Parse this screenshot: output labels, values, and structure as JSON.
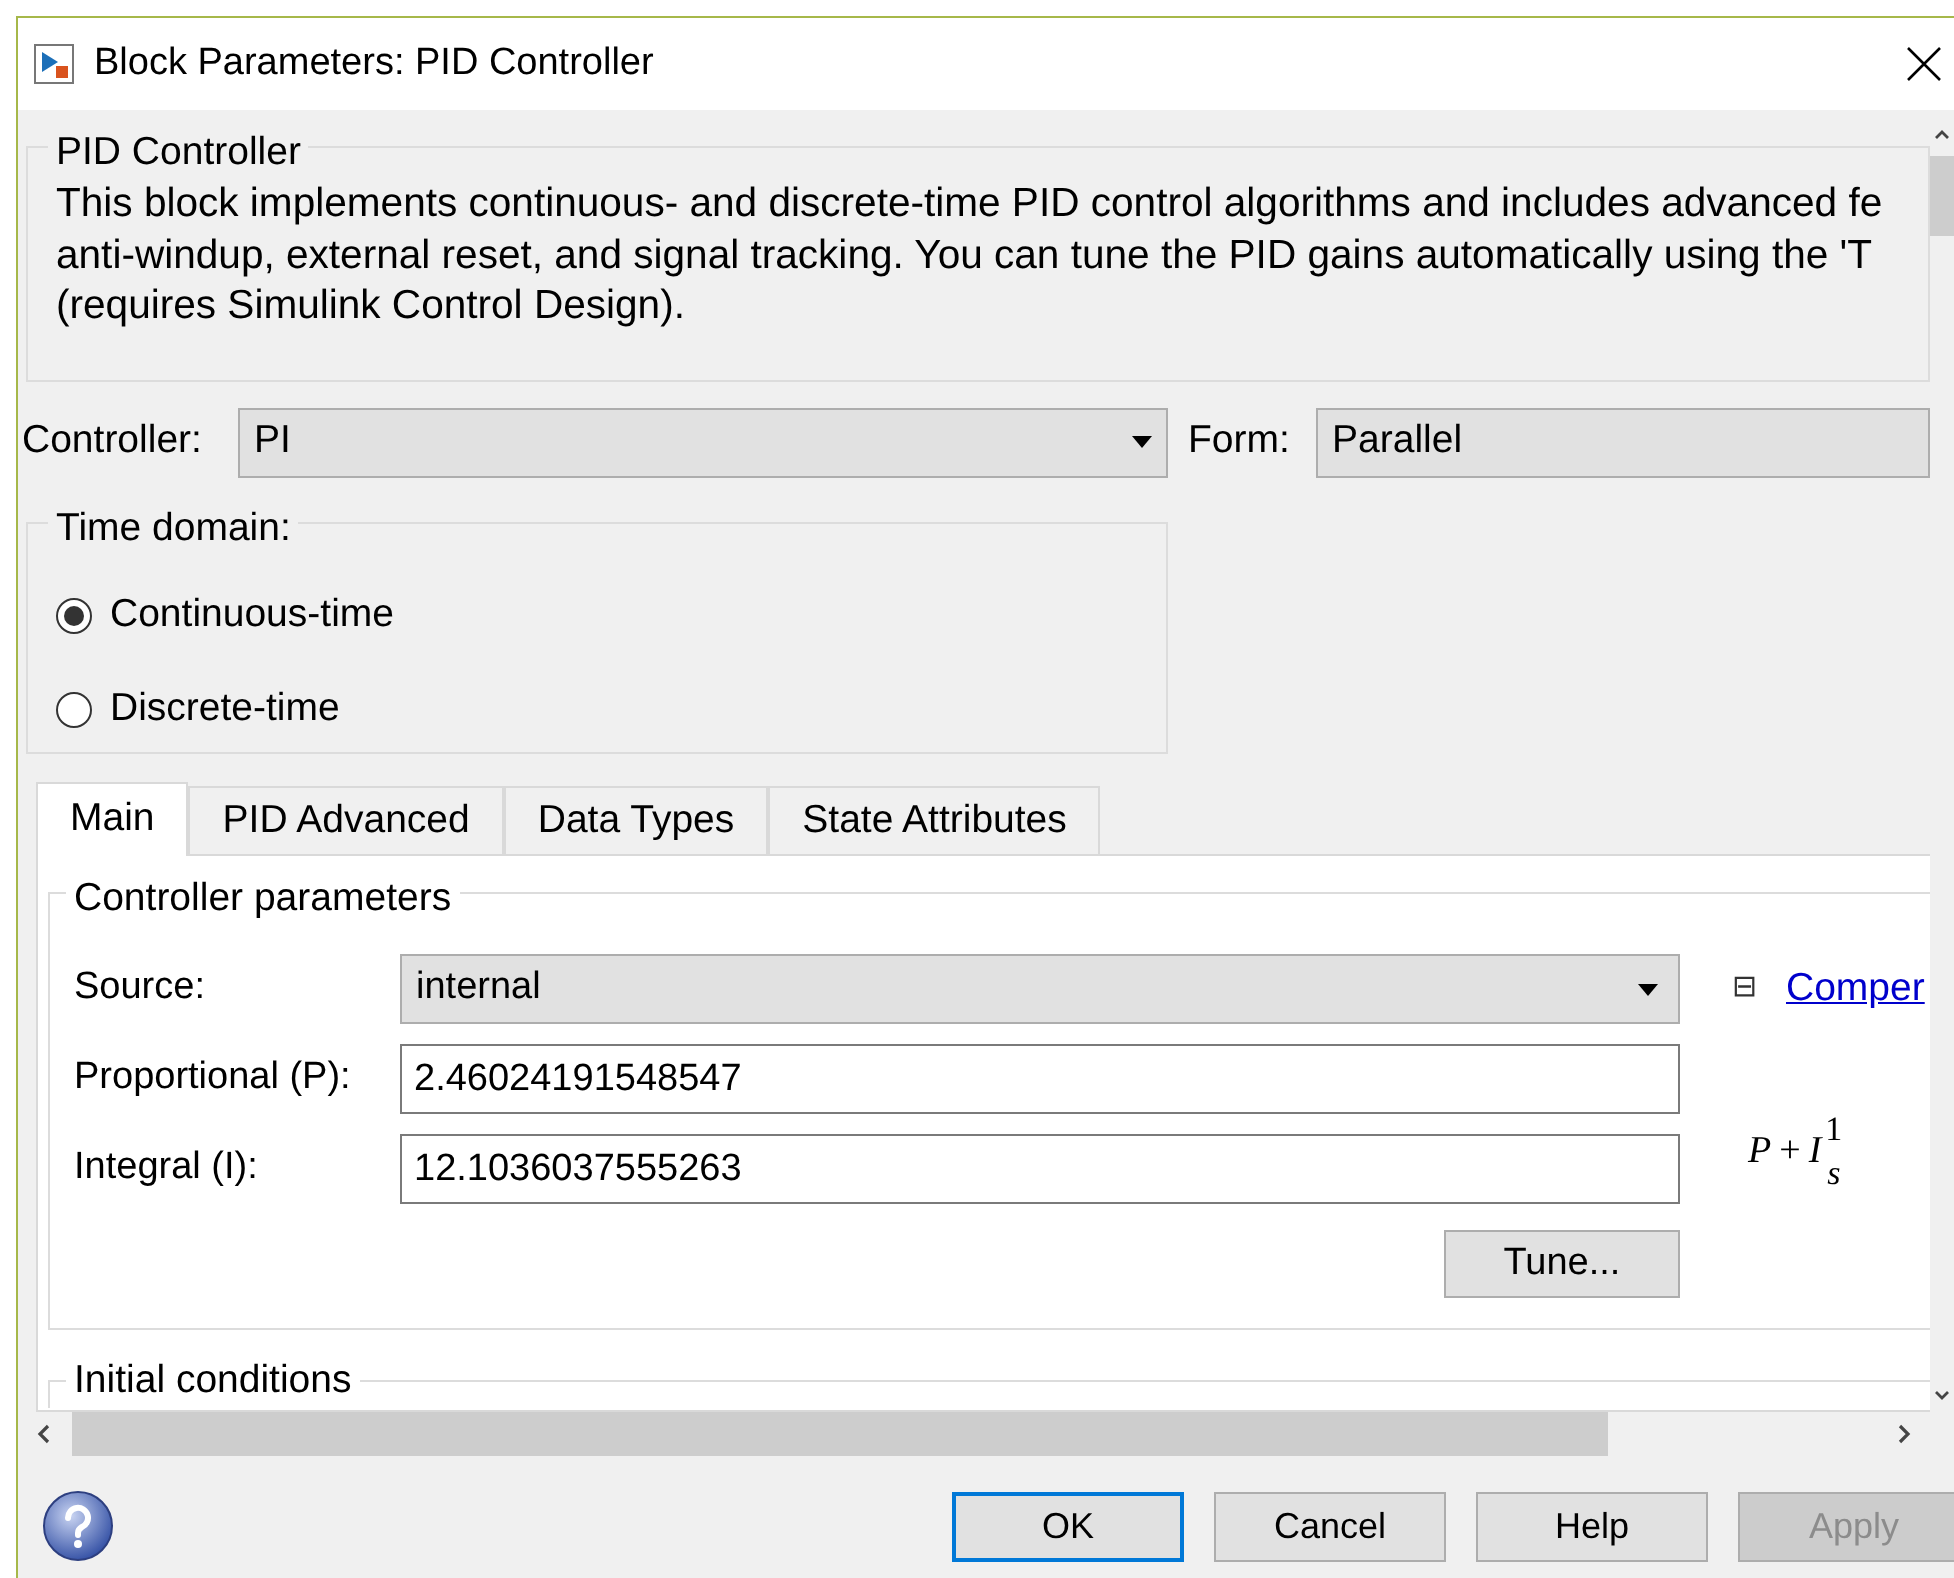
{
  "window": {
    "title": "Block Parameters: PID Controller"
  },
  "description": {
    "title": "PID Controller",
    "lines": [
      "This block implements continuous- and discrete-time PID control algorithms and includes advanced fe",
      "anti-windup, external reset, and signal tracking. You can tune the PID gains automatically using the 'T",
      "(requires Simulink Control Design)."
    ]
  },
  "controller": {
    "label": "Controller:",
    "value": "PI"
  },
  "form": {
    "label": "Form:",
    "value": "Parallel"
  },
  "time_domain": {
    "title": "Time domain:",
    "options": [
      {
        "label": "Continuous-time",
        "selected": true
      },
      {
        "label": "Discrete-time",
        "selected": false
      }
    ]
  },
  "tabs": [
    {
      "label": "Main",
      "selected": true
    },
    {
      "label": "PID Advanced",
      "selected": false
    },
    {
      "label": "Data Types",
      "selected": false
    },
    {
      "label": "State Attributes",
      "selected": false
    }
  ],
  "controller_parameters": {
    "title": "Controller parameters",
    "source": {
      "label": "Source:",
      "value": "internal"
    },
    "fields": [
      {
        "label": "Proportional (P):",
        "value": "2.46024191548547"
      },
      {
        "label": "Integral (I):",
        "value": "12.1036037555263"
      }
    ],
    "tune_button": "Tune...",
    "collapse_toggle": "⊟",
    "link": "Comper",
    "formula": {
      "p": "P",
      "plus": "+",
      "i": "I",
      "numerator": "1",
      "denominator": "s"
    }
  },
  "initial_conditions": {
    "title": "Initial conditions"
  },
  "buttons": [
    {
      "label": "OK",
      "disabled": false,
      "focused": true
    },
    {
      "label": "Cancel",
      "disabled": false,
      "focused": false
    },
    {
      "label": "Help",
      "disabled": false,
      "focused": false
    },
    {
      "label": "Apply",
      "disabled": true,
      "focused": false
    }
  ]
}
